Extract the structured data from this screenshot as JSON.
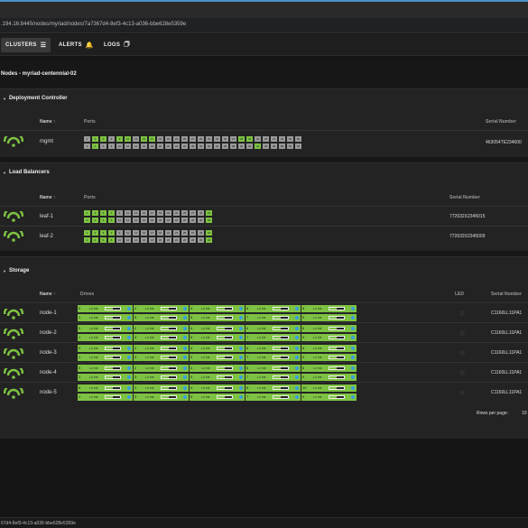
{
  "browser": {
    "url": ".194.16:8445/nodes/myriad/nodes/7a7367d4-8ef3-4c13-a036-bbe628e5359e"
  },
  "nav": {
    "items": [
      {
        "label": "CLUSTERS",
        "icon": "server-icon",
        "active": true
      },
      {
        "label": "ALERTS",
        "icon": "bell-icon",
        "active": false
      },
      {
        "label": "LOGS",
        "icon": "logs-icon",
        "active": false
      }
    ]
  },
  "page": {
    "title": "Nodes - myriad-centennial-02"
  },
  "deployment": {
    "title": "Deployment Controller",
    "col_name": "Name",
    "col_ports": "Ports",
    "col_serial": "Serial Number",
    "nodes": [
      {
        "name": "mgmt",
        "serial": "463054TE234600",
        "ports": [
          "1",
          "3",
          "2",
          "4",
          "3",
          "5",
          "4",
          "6",
          "9",
          "10",
          "11",
          "12",
          "13",
          "14",
          "15",
          "16",
          "17",
          "18",
          "19",
          "20",
          "21",
          "22",
          "23",
          "24",
          "25",
          "26",
          "27",
          "28",
          "29",
          "30",
          "31",
          "32",
          "33",
          "34",
          "35",
          "36",
          "37",
          "38",
          "39",
          "40",
          "41",
          "42",
          "43",
          "44",
          "45",
          "46",
          "47",
          "48",
          "49",
          "50",
          "51",
          "52",
          "53",
          "54"
        ],
        "ports_up": [
          2,
          3,
          4,
          8,
          10,
          14,
          16,
          38,
          40,
          43
        ]
      }
    ]
  },
  "loadbalancers": {
    "title": "Load Balancers",
    "col_name": "Name",
    "col_ports": "Ports",
    "col_serial": "Serial Number",
    "nodes": [
      {
        "name": "leaf-1",
        "serial": "772632X2345015",
        "ports": [
          "1",
          "2",
          "3",
          "4",
          "5",
          "6",
          "7",
          "8",
          "9",
          "10",
          "11",
          "12",
          "13",
          "14",
          "15",
          "16",
          "17",
          "18",
          "19",
          "20",
          "21",
          "22",
          "23",
          "24",
          "25",
          "26",
          "27",
          "28",
          "29",
          "30",
          "31",
          "32"
        ],
        "ports_up": [
          0,
          1,
          2,
          3,
          4,
          5,
          6,
          7,
          30,
          31
        ]
      },
      {
        "name": "leaf-2",
        "serial": "772632X2345009",
        "ports": [
          "1",
          "2",
          "3",
          "4",
          "5",
          "6",
          "7",
          "8",
          "9",
          "10",
          "11",
          "12",
          "13",
          "14",
          "15",
          "16",
          "17",
          "18",
          "19",
          "20",
          "21",
          "22",
          "23",
          "24",
          "25",
          "26",
          "27",
          "28",
          "29",
          "30",
          "31",
          "32"
        ],
        "ports_up": [
          0,
          1,
          2,
          3,
          4,
          5,
          6,
          7,
          30,
          31
        ]
      }
    ]
  },
  "storage": {
    "title": "Storage",
    "col_name": "Name",
    "col_drives": "Drives",
    "col_led": "LED",
    "col_serial": "Serial Number",
    "drive_capacity": "1.6 TiB",
    "drive_fill": 0.5,
    "nodes": [
      {
        "name": "node-1",
        "serial": "C1160LL11PA1",
        "drives": [
          "0",
          "2",
          "4",
          "6",
          "8",
          "1",
          "3",
          "5",
          "7",
          "9"
        ]
      },
      {
        "name": "node-2",
        "serial": "C1160LL11PA1",
        "drives": [
          "0",
          "2",
          "4",
          "6",
          "8",
          "1",
          "3",
          "5",
          "7",
          "9"
        ]
      },
      {
        "name": "node-3",
        "serial": "C1160LL11PA1",
        "drives": [
          "0",
          "2",
          "4",
          "6",
          "8",
          "1",
          "3",
          "5",
          "7",
          "9"
        ]
      },
      {
        "name": "node-4",
        "serial": "C1160LL11PA1",
        "drives": [
          "0",
          "2",
          "4",
          "6",
          "8",
          "1",
          "3",
          "5",
          "7",
          "9"
        ]
      },
      {
        "name": "node-5",
        "serial": "C1160LL11PA1",
        "drives": [
          "8",
          "2",
          "4",
          "6",
          "10",
          "1",
          "3",
          "5",
          "7",
          "9"
        ]
      }
    ],
    "rows_per_page_label": "Rows per page:",
    "rows_per_page_value": "10"
  },
  "status": {
    "text": "67d4-8ef3-4c13-a036-bbe628e5359e"
  },
  "colors": {
    "accent": "#7dc242",
    "port_down": "#9a9a9a",
    "drive_dot": "#3aa0e0"
  }
}
